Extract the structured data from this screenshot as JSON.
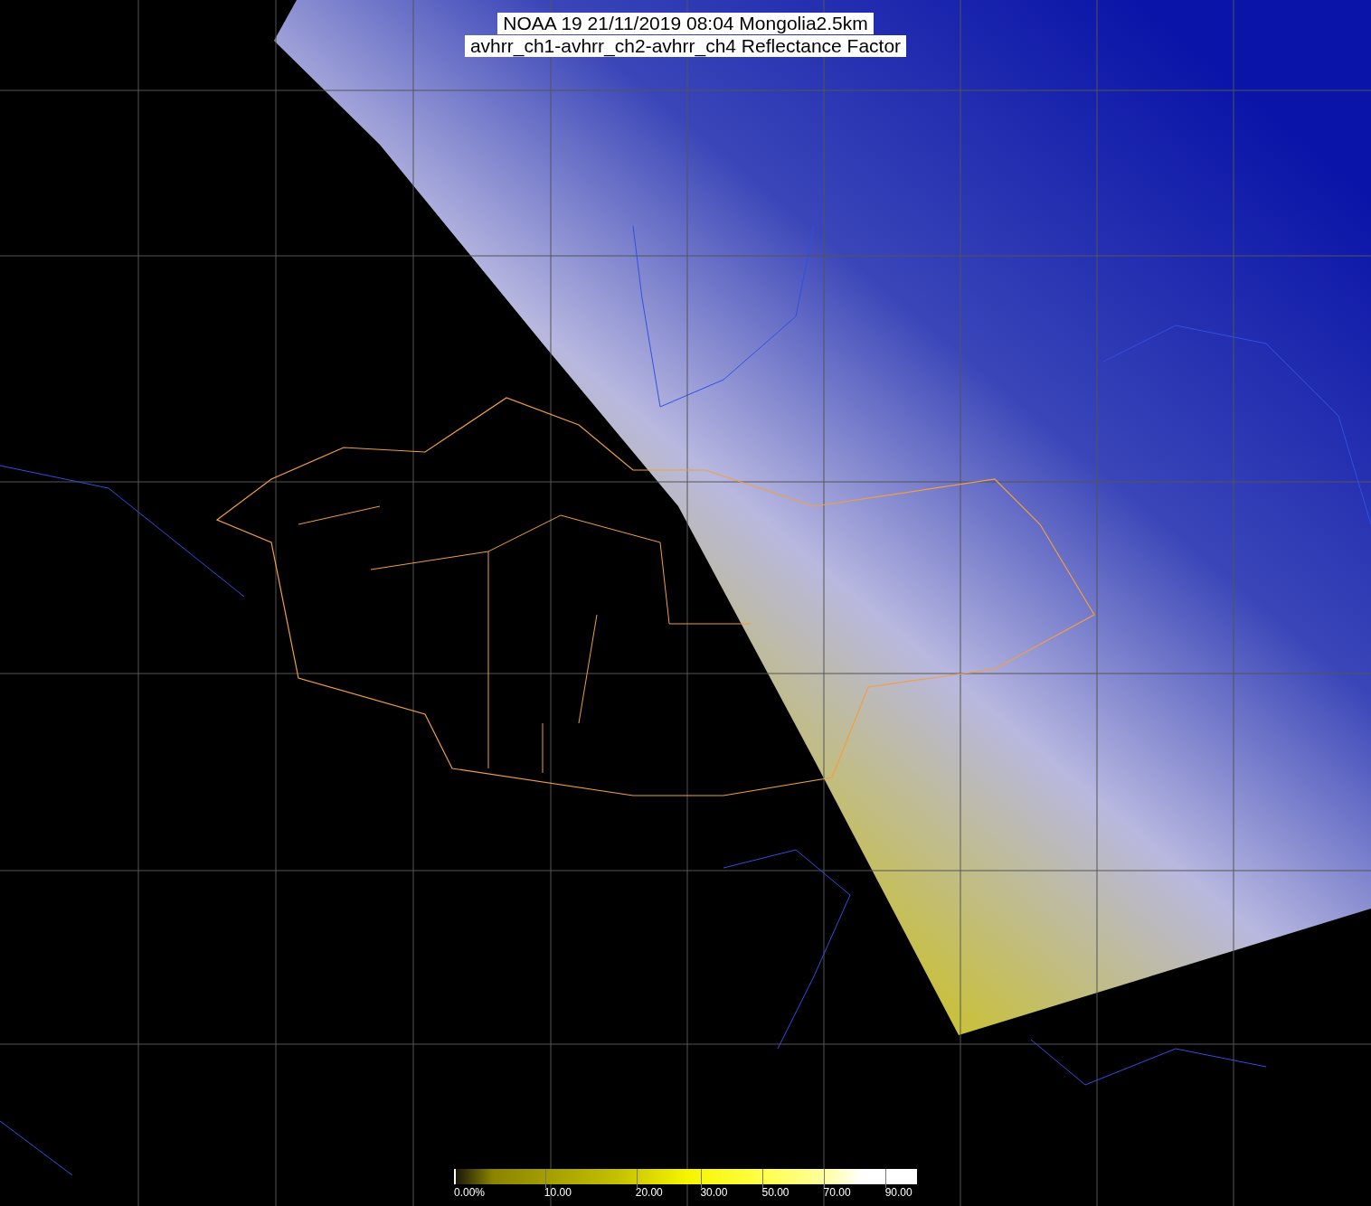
{
  "title": {
    "lines": [
      "NOAA 19 21/11/2019 08:04 Mongolia2.5km",
      "avhrr_ch1-avhrr_ch2-avhrr_ch4 Reflectance Factor"
    ]
  },
  "colorbar": {
    "ticks": [
      "0.00%",
      "10.00",
      "20.00",
      "30.00",
      "50.00",
      "70.00",
      "90.00"
    ]
  }
}
